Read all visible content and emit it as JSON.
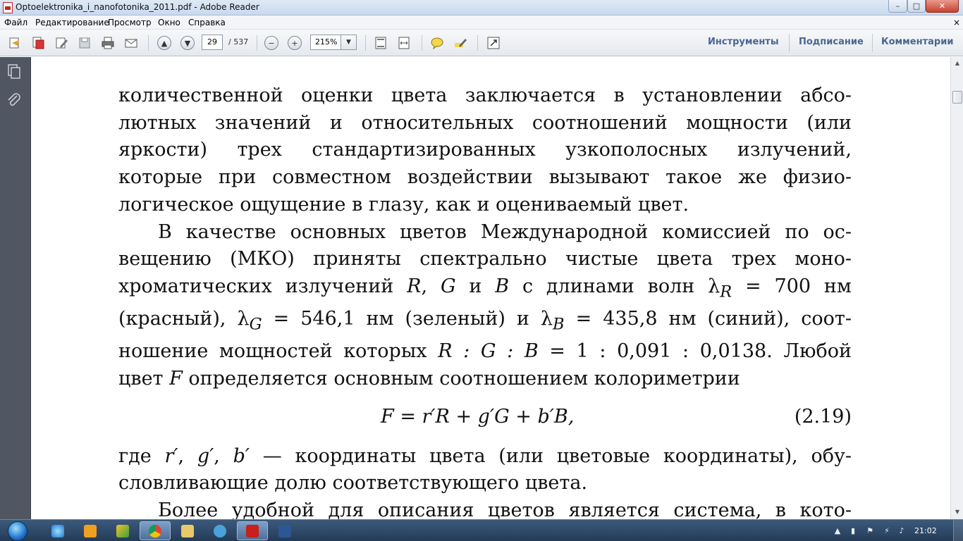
{
  "window": {
    "title": "Optoelektronika_i_nanofotonika_2011.pdf - Adobe Reader",
    "minimize": "–",
    "maximize": "□",
    "close": "✕"
  },
  "menu": {
    "items": [
      "Файл",
      "Редактирование",
      "Просмотр",
      "Окно",
      "Справка"
    ],
    "close_doc": "×"
  },
  "toolbar": {
    "page_current": "29",
    "page_total": "/ 537",
    "zoom": "215%",
    "right_tabs": [
      "Инструменты",
      "Подписание",
      "Комментарии"
    ],
    "icons": [
      "create-icon",
      "combine-icon",
      "edit-icon",
      "save-icon",
      "print-icon",
      "email-icon",
      "page-up-icon",
      "page-down-icon",
      "zoom-out-icon",
      "zoom-in-icon",
      "fit-page-icon",
      "fit-width-icon",
      "comment-icon",
      "highlight-icon",
      "fullscreen-icon"
    ]
  },
  "nav": {
    "icons": [
      "pages-icon",
      "attachments-icon"
    ]
  },
  "document": {
    "para1_lines": [
      "количественной оценки цвета заключается в установлении абсо-",
      "лютных значений и относительных соотношений мощности (или",
      "яркости) трех стандартизированных узкополосных излучений,",
      "которые при совместном воздействии вызывают такое же физио-",
      "логическое ощущение в глазу, как и оцениваемый цвет."
    ],
    "para2": {
      "l1": "В качестве основных цветов Международной комиссией по ос-",
      "l2": "вещению (МКО) приняты спектрально чистые цвета трех моно-",
      "l3_a": "хроматических излучений",
      "l3_R": "R",
      "l3_G": "G",
      "l3_and": "и",
      "l3_B": "B",
      "l3_b": "с длинами волн",
      "lambda": "λ",
      "sub_R": "R",
      "l3_val": "= 700 нм",
      "l4_a": "(красный),",
      "sub_G": "G",
      "l4_b": "= 546,1 нм (зеленый) и",
      "sub_B": "B",
      "l4_c": "= 435,8 нм (синий), соот-",
      "l5_a": "ношение мощностей которых",
      "l5_ratio": "R : G : B",
      "l5_b": "= 1 : 0,091 : 0,0138. Любой",
      "l6_a": "цвет",
      "l6_F": "F",
      "l6_b": "определяется основным соотношением колориметрии"
    },
    "equation": {
      "body": "F = r′R + g′G + b′B,",
      "number": "(2.19)"
    },
    "para3": {
      "l1_a": "где",
      "r": "r′",
      "g": "g′",
      "b": "b′",
      "l1_b": "— координаты цвета (или цветовые координаты), обу-",
      "l2": "словливающие долю соответствующего цвета."
    },
    "para4_line": "Более удобной для описания цветов является система, в кото-"
  },
  "taskbar": {
    "clock": "21:02",
    "apps": [
      "ie-icon",
      "media-player-icon",
      "winamp-icon",
      "chrome-icon",
      "explorer-icon",
      "app-icon",
      "adobe-reader-icon",
      "word-icon"
    ]
  }
}
